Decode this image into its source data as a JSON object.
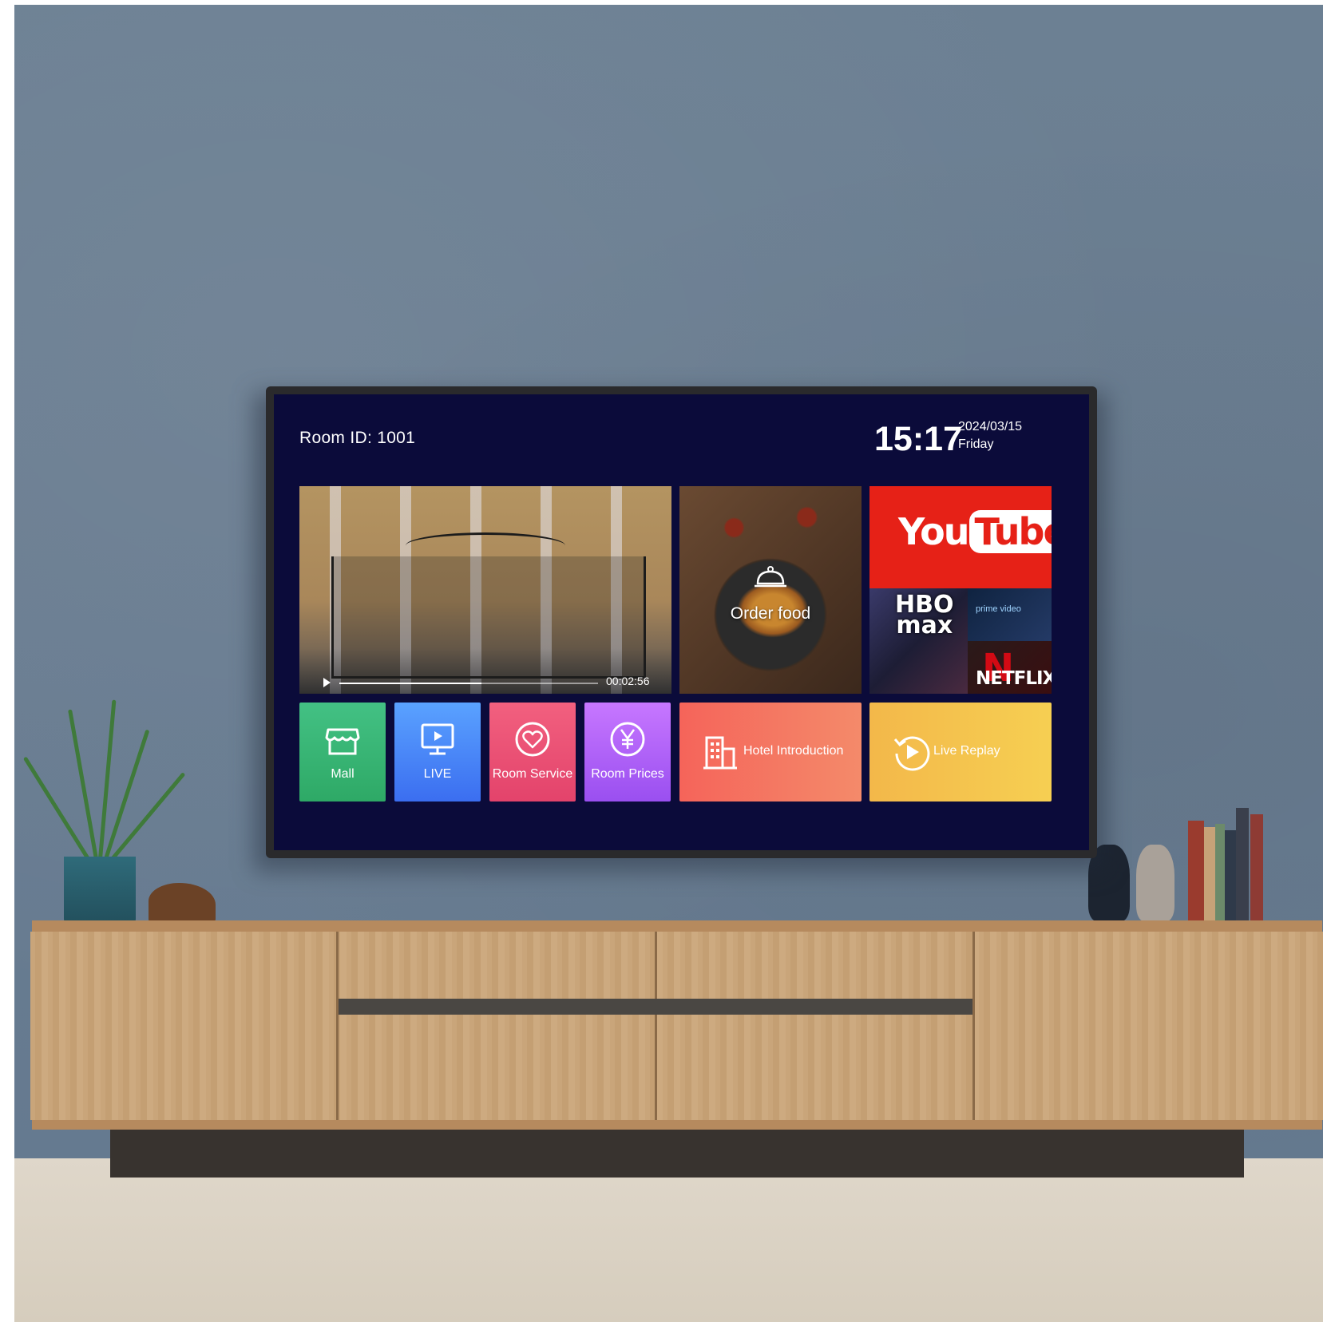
{
  "room": {
    "label": "Room ID:  1001"
  },
  "clock": {
    "time": "15:17",
    "date": "2024/03/15",
    "day": "Friday"
  },
  "video": {
    "elapsed": "00:02:56",
    "progress": 0.55
  },
  "tiles": {
    "order_food": "Order food",
    "youtube": {
      "you": "You",
      "tube": "Tube"
    },
    "hbo": {
      "line1": "HBO",
      "line2": "max"
    },
    "prime": "prime video",
    "netflix": "NETFLIX"
  },
  "buttons": {
    "mall": "Mall",
    "live": "LIVE",
    "room_service": "Room Service",
    "room_prices": "Room Prices",
    "hotel_intro": "Hotel Introduction",
    "live_replay": "Live Replay"
  },
  "colors": {
    "screen_bg": "#0b0b3a",
    "mall": "#36b574",
    "live": "#4a86f7",
    "room_service": "#eb5275",
    "room_prices": "#b063f8",
    "hotel_intro": "#f47562",
    "live_replay": "#f5c34e",
    "youtube": "#e62117"
  },
  "icons": {
    "play": "play-icon",
    "food": "cloche-icon",
    "mall": "store-icon",
    "live": "monitor-play-icon",
    "room_service": "heart-icon",
    "room_prices": "yen-icon",
    "hotel_intro": "building-icon",
    "live_replay": "replay-icon"
  }
}
